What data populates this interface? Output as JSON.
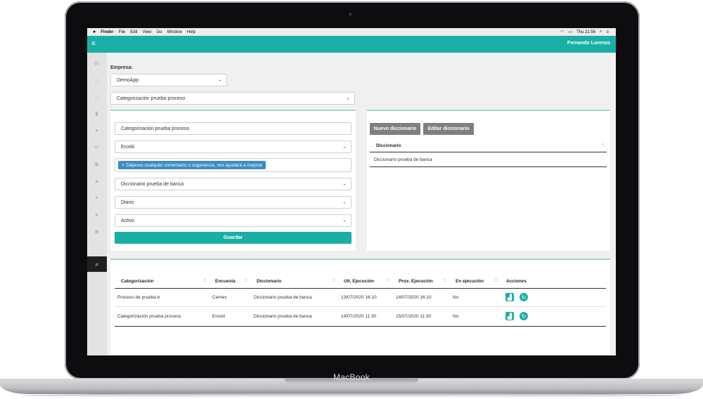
{
  "device": {
    "brand": "MacBook"
  },
  "menubar": {
    "apple": "",
    "items": [
      "Finder",
      "File",
      "Edit",
      "View",
      "Go",
      "Window",
      "Help"
    ],
    "clock": "Thu 21:56"
  },
  "topnav": {
    "user": "Fernando Lorenzo"
  },
  "sidebar": {
    "icons": [
      "mail-icon",
      "home-icon",
      "home-icon",
      "chart-bar-icon",
      "chat-icon",
      "envelope-icon",
      "globe-icon",
      "bell-icon",
      "twitter-icon",
      "chat-icon",
      "globe-icon"
    ],
    "active_icon": "search-icon"
  },
  "filters": {
    "empresa_label": "Empresa:",
    "empresa_value": "DemoApp",
    "categorizacion_value": "Categorización prueba proceso"
  },
  "form": {
    "name_value": "Categorización prueba proceso",
    "encuesta_value": "Eroski",
    "question_tag": "Déjenos cualquier comentario o sugerencia, nos ayudará a mejorar",
    "diccionario_value": "Diccionario prueba de banca",
    "frecuencia_value": "Diario",
    "estado_value": "Activo",
    "save_label": "Guardar"
  },
  "dictionary_panel": {
    "new_label": "Nuevo diccionario",
    "edit_label": "Editar diccionario",
    "column": "Diccionario",
    "rows": [
      "Diccionario prueba de banca"
    ]
  },
  "table": {
    "headers": [
      "Categorización",
      "Encuesta",
      "Diccionario",
      "Ult. Ejecución",
      "Prox. Ejecución",
      "En ejecución",
      "Acciones"
    ],
    "rows": [
      [
        "Proceso de prueba b",
        "Cemex",
        "Diccionario prueba de banca",
        "13/07/2020 16:10",
        "14/07/2020 16:10",
        "No"
      ],
      [
        "Categorización prueba proceso",
        "Eroski",
        "Diccionario prueba de banca",
        "14/07/2020 11:30",
        "15/07/2020 11:30",
        "No"
      ]
    ]
  },
  "colors": {
    "accent": "#1aafa4",
    "tag": "#3e8ebf",
    "button_gray": "#7f7f7f"
  }
}
